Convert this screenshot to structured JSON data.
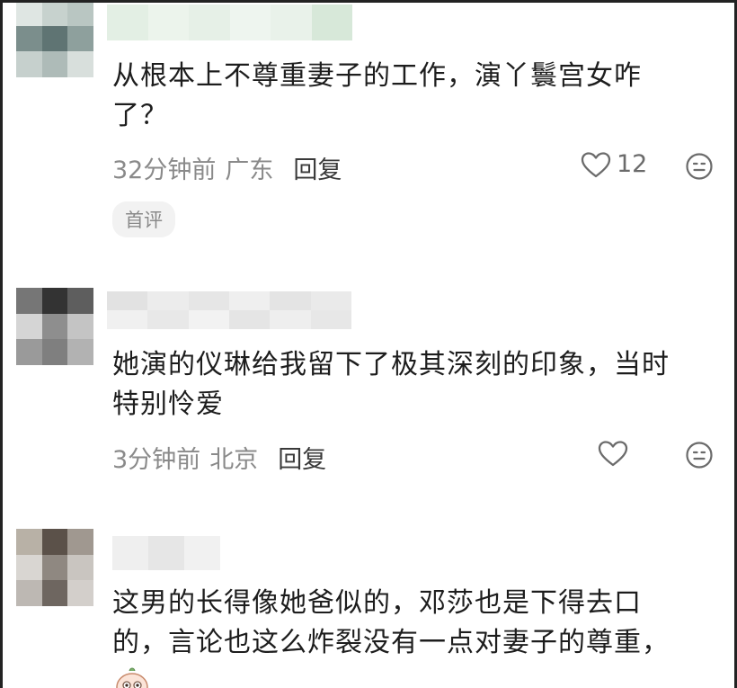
{
  "comments": [
    {
      "text_line1": "从根本上不尊重妻子的工作，演丫鬟宫女咋",
      "text_line2": "了？",
      "time": "32分钟前",
      "region": "广东",
      "reply_label": "回复",
      "like_count": "12",
      "badge": "首评"
    },
    {
      "text_line1": "她演的仪琳给我留下了极其深刻的印象，当时",
      "text_line2": "特别怜爱",
      "time": "3分钟前",
      "region": "北京",
      "reply_label": "回复",
      "like_count": ""
    },
    {
      "text_line1": "这男的长得像她爸似的，邓莎也是下得去口",
      "text_line2": "的，言论也这么炸裂没有一点对妻子的尊重，"
    }
  ],
  "icons": {
    "like": "heart-outline-icon",
    "reaction": "smiley-face-icon",
    "emoji": "emoji-sticker-icon"
  },
  "colors": {
    "text": "#1d1d1d",
    "meta": "#8a8a8a",
    "reply": "#3a3a3a",
    "badge_bg": "#f2f2f2"
  }
}
